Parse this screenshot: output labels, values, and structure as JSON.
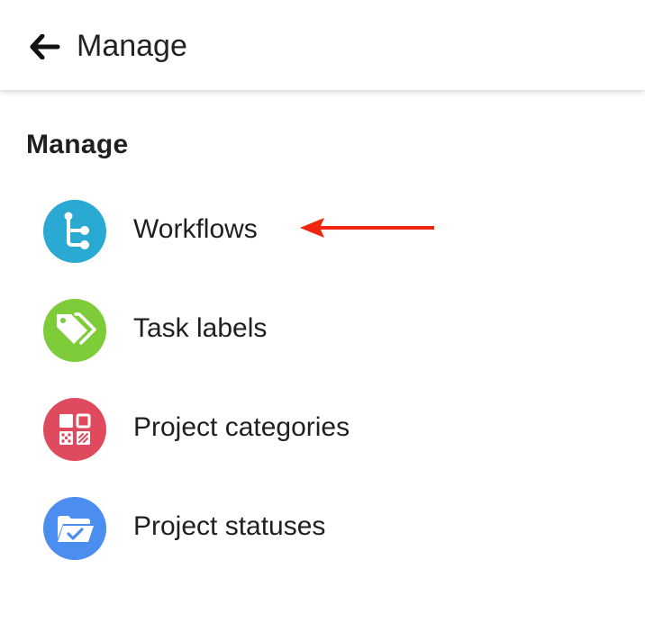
{
  "header": {
    "back_icon": "arrow-left-icon",
    "title": "Manage"
  },
  "section": {
    "title": "Manage"
  },
  "menu": {
    "items": [
      {
        "label": "Workflows",
        "icon": "workflow-icon",
        "color": "#2aa9d2"
      },
      {
        "label": "Task labels",
        "icon": "tag-icon",
        "color": "#7fcc3a"
      },
      {
        "label": "Project categories",
        "icon": "category-grid-icon",
        "color": "#e04a5e"
      },
      {
        "label": "Project statuses",
        "icon": "folder-check-icon",
        "color": "#4c8ef0"
      }
    ]
  },
  "annotation": {
    "arrow_color": "#f0260f"
  }
}
